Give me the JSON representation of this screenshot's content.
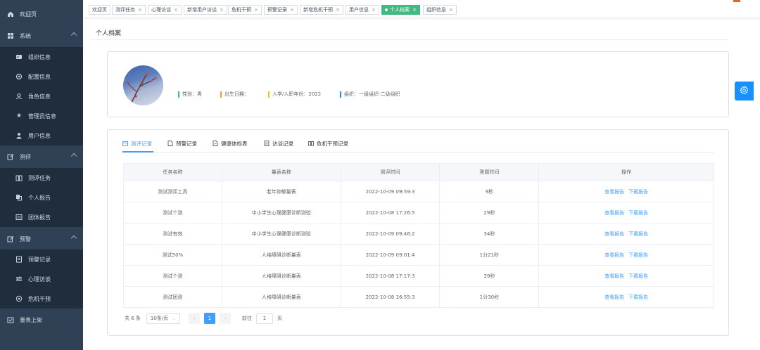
{
  "sidebar": {
    "items": [
      {
        "label": "欢迎页",
        "icon": "home-icon",
        "level": "top"
      },
      {
        "label": "系统",
        "icon": "grid-icon",
        "level": "group"
      },
      {
        "label": "组织信息",
        "icon": "id-card-icon",
        "level": "sub"
      },
      {
        "label": "配置信息",
        "icon": "settings-icon",
        "level": "sub"
      },
      {
        "label": "角色信息",
        "icon": "user-icon",
        "level": "sub"
      },
      {
        "label": "管理员信息",
        "icon": "star-icon",
        "level": "sub"
      },
      {
        "label": "用户信息",
        "icon": "person-icon",
        "level": "sub"
      },
      {
        "label": "测评",
        "icon": "edit-icon",
        "level": "group"
      },
      {
        "label": "测评任务",
        "icon": "book-icon",
        "level": "sub"
      },
      {
        "label": "个人报告",
        "icon": "copy-icon",
        "level": "sub"
      },
      {
        "label": "团体报告",
        "icon": "list-icon",
        "level": "sub"
      },
      {
        "label": "预警",
        "icon": "edit-icon",
        "level": "group"
      },
      {
        "label": "预警记录",
        "icon": "document-icon",
        "level": "sub"
      },
      {
        "label": "心理访谈",
        "icon": "sliders-icon",
        "level": "sub"
      },
      {
        "label": "危机干预",
        "icon": "target-icon",
        "level": "sub"
      },
      {
        "label": "量表上架",
        "icon": "upload-icon",
        "level": "top"
      }
    ]
  },
  "tags": [
    {
      "label": "欢迎页",
      "closable": false,
      "active": false
    },
    {
      "label": "测评任务",
      "closable": true,
      "active": false
    },
    {
      "label": "心理访谈",
      "closable": true,
      "active": false
    },
    {
      "label": "新增用户访谈",
      "closable": true,
      "active": false
    },
    {
      "label": "危机干预",
      "closable": true,
      "active": false
    },
    {
      "label": "预警记录",
      "closable": true,
      "active": false
    },
    {
      "label": "新增危机干预",
      "closable": true,
      "active": false
    },
    {
      "label": "用户信息",
      "closable": true,
      "active": false
    },
    {
      "label": "个人档案",
      "closable": true,
      "active": true
    },
    {
      "label": "组织信息",
      "closable": true,
      "active": false
    }
  ],
  "page_title": "个人档案",
  "profile": {
    "gender": "性别：男",
    "birth": "出生日期：",
    "enroll": "入学/入职年份：2022",
    "org": "组织：一级组织-二级组织",
    "colors": {
      "gender": "#2ecc71",
      "birth": "#ff9a2e",
      "enroll": "#f5c518",
      "org": "#1890ff"
    }
  },
  "tabs": [
    {
      "label": "测评记录",
      "icon": "calendar-icon",
      "active": true
    },
    {
      "label": "预警记录",
      "icon": "file-icon",
      "active": false
    },
    {
      "label": "健康体检表",
      "icon": "doc-icon",
      "active": false
    },
    {
      "label": "访谈记录",
      "icon": "notes-icon",
      "active": false
    },
    {
      "label": "危机干预记录",
      "icon": "book-icon",
      "active": false
    }
  ],
  "table": {
    "headers": [
      "任务名称",
      "量表名称",
      "测评时间",
      "答题时间",
      "操作"
    ],
    "rows": [
      [
        "测试测评工具",
        "老年抑郁量表",
        "2022-10-09 09:59:3",
        "9秒"
      ],
      [
        "测试个测",
        "中小学生心理健康诊断测验",
        "2022-10-08 17:26:5",
        "29秒"
      ],
      [
        "测试有效",
        "中小学生心理健康诊断测验",
        "2022-10-09 09:46:2",
        "34秒"
      ],
      [
        "测试50%",
        "人格障碍诊断量表",
        "2022-10-09 09:01:4",
        "1分21秒"
      ],
      [
        "测试个测",
        "人格障碍诊断量表",
        "2022-10-08 17:17:3",
        "39秒"
      ],
      [
        "测试团测",
        "人格障碍诊断量表",
        "2022-10-08 16:55:3",
        "1分30秒"
      ]
    ],
    "actions": [
      "查看报告",
      "下载报告"
    ]
  },
  "pager": {
    "total": "共 6 条",
    "size": "10条/页",
    "current": "1",
    "goto_label": "前往",
    "goto_value": "1",
    "page_unit": "页"
  },
  "accent": "#409eff"
}
